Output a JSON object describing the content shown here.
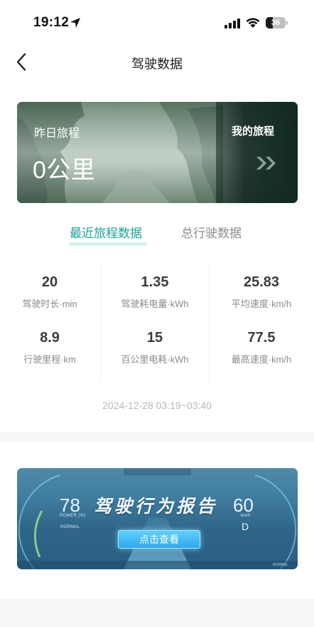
{
  "status_bar": {
    "time": "19:12",
    "battery_level": "36",
    "icons": [
      "location-arrow-icon",
      "signal-icon",
      "wifi-icon",
      "battery-icon"
    ]
  },
  "nav": {
    "back_icon": "chevron-left-icon",
    "title": "驾驶数据"
  },
  "banner": {
    "yesterday_label": "昨日旅程",
    "yesterday_value": "0公里",
    "my_trip_label": "我的旅程",
    "chevron_icon": "double-chevron-right-icon"
  },
  "tabs": [
    {
      "label": "最近旅程数据",
      "active": true
    },
    {
      "label": "总行驶数据",
      "active": false
    }
  ],
  "stats": [
    {
      "value": "20",
      "label": "驾驶时长·min"
    },
    {
      "value": "1.35",
      "label": "驾驶耗电量·kWh"
    },
    {
      "value": "25.83",
      "label": "平均速度·km/h"
    },
    {
      "value": "8.9",
      "label": "行驶里程·km"
    },
    {
      "value": "15",
      "label": "百公里电耗·kWh"
    },
    {
      "value": "77.5",
      "label": "最高速度·km/h"
    }
  ],
  "trip_time": "2024-12-28 03:19~03:40",
  "report": {
    "title": "驾驶行为报告",
    "button_label": "点击查看",
    "left_gauge_value": "78",
    "left_gauge_caption": "POWER (%)",
    "left_gauge_mode": "NORMAL",
    "right_gauge_value": "60",
    "right_gauge_unit": "km/h",
    "right_gauge_gear": "D",
    "bottom_right_text": "NORMAL"
  },
  "colors": {
    "accent": "#19a595",
    "tab_underline": "#d6f1ee",
    "banner_dark": "#0f2a22"
  }
}
